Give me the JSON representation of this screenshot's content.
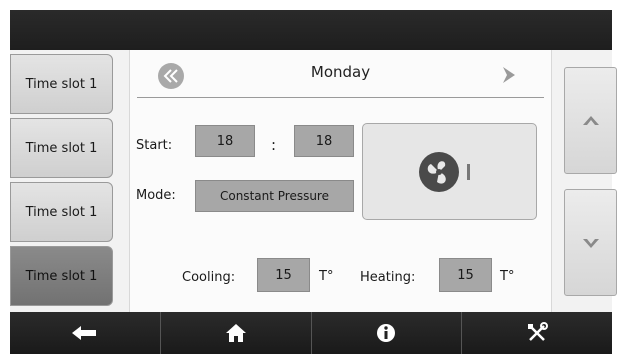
{
  "slots": [
    {
      "label": "Time slot 1"
    },
    {
      "label": "Time slot 1"
    },
    {
      "label": "Time slot 1"
    },
    {
      "label": "Time slot 1"
    }
  ],
  "header": {
    "day": "Monday"
  },
  "start": {
    "label": "Start:",
    "hour": "18",
    "separator": ":",
    "minute": "18"
  },
  "mode": {
    "label": "Mode:",
    "value": "Constant Pressure"
  },
  "cooling": {
    "label": "Cooling:",
    "value": "15",
    "unit": "T°"
  },
  "heating": {
    "label": "Heating:",
    "value": "15",
    "unit": "T°"
  },
  "icons": {
    "prev": "double-chevron-left-icon",
    "next": "chevron-right-icon",
    "fan": "fan-icon",
    "scroll_up": "chevron-up-icon",
    "scroll_down": "chevron-down-icon",
    "nav": [
      "back-arrow-icon",
      "home-icon",
      "info-icon",
      "tools-icon"
    ]
  },
  "colors": {
    "active_slot": "#7e7e7e",
    "value_box": "#a7a7a7"
  }
}
